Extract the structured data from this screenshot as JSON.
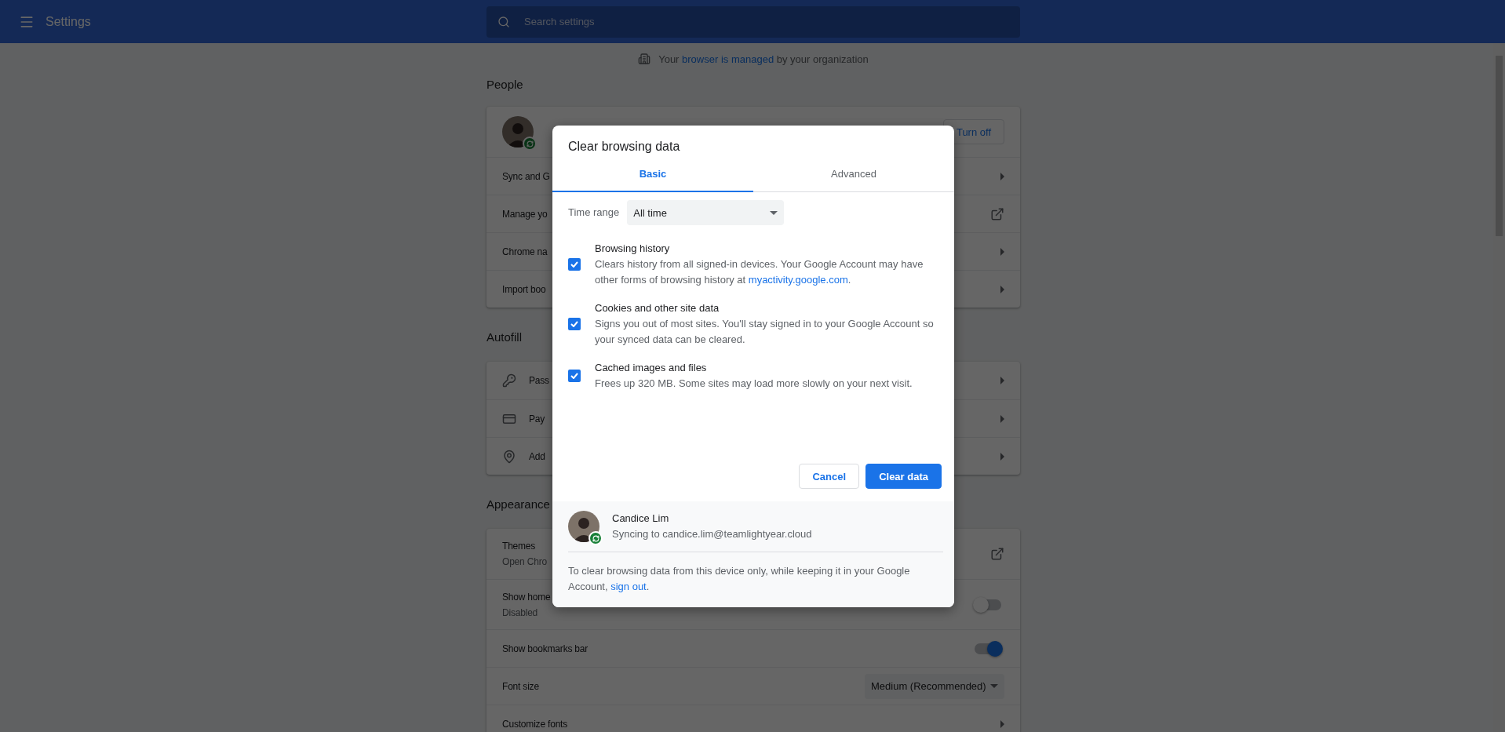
{
  "header": {
    "title": "Settings",
    "search": {
      "placeholder": "Search settings"
    }
  },
  "managed_notice": {
    "before": "Your ",
    "link": "browser is managed",
    "after": " by your organization"
  },
  "sections": [
    {
      "kind": "people",
      "heading": "People",
      "rows": [
        {
          "kind": "profile",
          "button": "Turn off"
        },
        {
          "kind": "arrow",
          "label": "Sync and G"
        },
        {
          "kind": "external",
          "label": "Manage yo"
        },
        {
          "kind": "arrow",
          "label": "Chrome na"
        },
        {
          "kind": "arrow",
          "label": "Import boo"
        }
      ]
    },
    {
      "kind": "autofill",
      "heading": "Autofill",
      "rows": [
        {
          "kind": "arrow",
          "label": "Pass"
        },
        {
          "kind": "arrow",
          "label": "Pay"
        },
        {
          "kind": "arrow",
          "label": "Add"
        }
      ]
    },
    {
      "kind": "appearance",
      "heading": "Appearance",
      "rows": [
        {
          "kind": "external",
          "label": "Themes",
          "sublabel": "Open Chro"
        },
        {
          "kind": "toggle",
          "label": "Show home",
          "sublabel": "Disabled",
          "on": false
        },
        {
          "kind": "toggle",
          "label": "Show bookmarks bar",
          "on": true
        },
        {
          "kind": "select",
          "label": "Font size",
          "value": "Medium (Recommended)"
        },
        {
          "kind": "arrow",
          "label": "Customize fonts"
        }
      ]
    }
  ],
  "dialog": {
    "title": "Clear browsing data",
    "tabs": [
      {
        "label": "Basic",
        "selected": true
      },
      {
        "label": "Advanced",
        "selected": false
      }
    ],
    "time_range": {
      "label": "Time range",
      "value": "All time"
    },
    "options": [
      {
        "title": "Browsing history",
        "description": "Clears history from all signed-in devices. Your Google Account may have other forms of browsing history at ",
        "link": "myactivity.google.com",
        "after": ".",
        "checked": true
      },
      {
        "title": "Cookies and other site data",
        "description": "Signs you out of most sites. You'll stay signed in to your Google Account so your synced data can be cleared.",
        "checked": true
      },
      {
        "title": "Cached images and files",
        "description": "Frees up 320 MB. Some sites may load more slowly on your next visit.",
        "checked": true
      }
    ],
    "buttons": [
      {
        "label": "Cancel",
        "kind": "secondary"
      },
      {
        "label": "Clear data",
        "kind": "primary"
      }
    ],
    "account": {
      "name": "Candice Lim",
      "status": "Syncing to candice.lim@teamlightyear.cloud"
    },
    "footer": {
      "text": "To clear browsing data from this device only, while keeping it in your Google Account, ",
      "link": "sign out",
      "after": "."
    }
  }
}
